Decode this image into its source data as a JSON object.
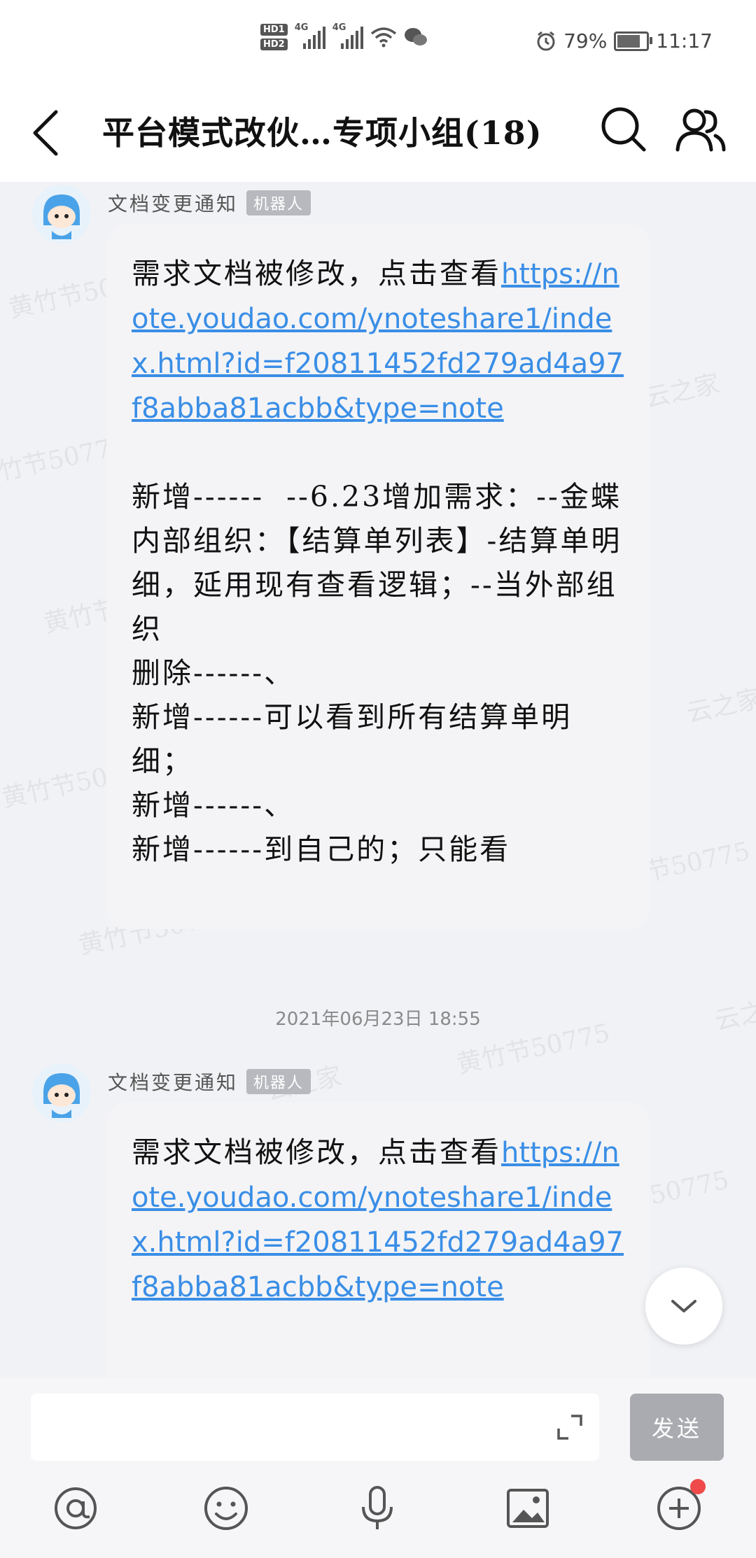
{
  "status_bar": {
    "hd1": "HD1",
    "hd2": "HD2",
    "net1": "4G",
    "net2": "4G",
    "battery": "79%",
    "time": "11:17"
  },
  "header": {
    "title": "平台模式改伙…专项小组(18)"
  },
  "watermark": {
    "name": "黄竹节50775",
    "org": "云之家"
  },
  "messages": [
    {
      "sender": "文档变更通知",
      "tag": "机器人",
      "intro": "需求文档被修改，点击查看",
      "link": "https://note.youdao.com/ynoteshare1/index.html?id=f20811452fd279ad4a97f8abba81acbb&type=note",
      "body": "\n\n新增------  --6.23增加需求：--金蝶内部组织：【结算单列表】-结算单明细，延用现有查看逻辑；--当外部组织\n删除------、\n新增------可以看到所有结算单明细；\n新增------、\n新增------到自己的；只能看"
    },
    {
      "sender": "文档变更通知",
      "tag": "机器人",
      "intro": "需求文档被修改，点击查看",
      "link": "https://note.youdao.com/ynoteshare1/index.html?id=f20811452fd279ad4a97f8abba81acbb&type=note",
      "body": ""
    }
  ],
  "timestamp": "2021年06月23日  18:55",
  "input": {
    "placeholder": "",
    "send_label": "发送"
  },
  "toolbar": {
    "icons": [
      "at-icon",
      "emoji-icon",
      "microphone-icon",
      "image-icon",
      "plus-icon"
    ]
  }
}
